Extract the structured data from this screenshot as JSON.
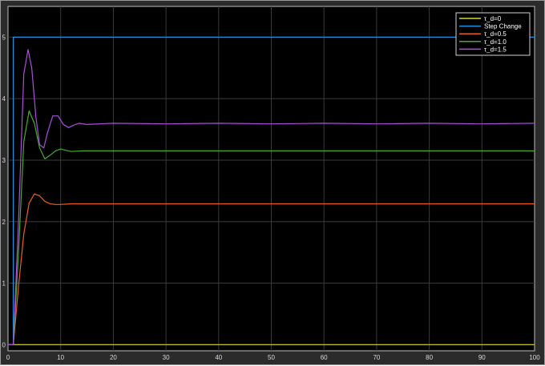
{
  "chart_data": {
    "type": "line",
    "title": "",
    "xlabel": "",
    "ylabel": "",
    "xlim": [
      0,
      100
    ],
    "ylim": [
      -0.1,
      5.5
    ],
    "grid": true,
    "legend_placement": "top-right",
    "x_ticks": [
      0,
      10,
      20,
      30,
      40,
      50,
      60,
      70,
      80,
      90,
      100
    ],
    "y_ticks": [
      0,
      1,
      2,
      3,
      4,
      5
    ],
    "background_color": "#000000",
    "grid_color": "#3a3a3a",
    "series": [
      {
        "name": "τ_d=0",
        "color": "#d6d62e",
        "points": [
          [
            0,
            0
          ],
          [
            100,
            0
          ]
        ]
      },
      {
        "name": "Step Change",
        "color": "#1f8fe0",
        "points": [
          [
            0,
            0
          ],
          [
            1,
            0
          ],
          [
            1,
            5
          ],
          [
            100,
            5
          ]
        ]
      },
      {
        "name": "τ_d=0.5",
        "color": "#e8601c",
        "points": [
          [
            0,
            0
          ],
          [
            1,
            0
          ],
          [
            2,
            0.95
          ],
          [
            3,
            1.8
          ],
          [
            4,
            2.3
          ],
          [
            5,
            2.45
          ],
          [
            6,
            2.42
          ],
          [
            7,
            2.33
          ],
          [
            8,
            2.29
          ],
          [
            9,
            2.28
          ],
          [
            10,
            2.28
          ],
          [
            12,
            2.29
          ],
          [
            20,
            2.29
          ],
          [
            40,
            2.29
          ],
          [
            60,
            2.29
          ],
          [
            80,
            2.29
          ],
          [
            100,
            2.29
          ]
        ]
      },
      {
        "name": "τ_d=1.0",
        "color": "#3fae2a",
        "points": [
          [
            0,
            0
          ],
          [
            1,
            0
          ],
          [
            2,
            1.5
          ],
          [
            3,
            3.3
          ],
          [
            4,
            3.8
          ],
          [
            5,
            3.6
          ],
          [
            6,
            3.2
          ],
          [
            7,
            3.02
          ],
          [
            8,
            3.08
          ],
          [
            9,
            3.15
          ],
          [
            10,
            3.18
          ],
          [
            11,
            3.16
          ],
          [
            12,
            3.14
          ],
          [
            14,
            3.15
          ],
          [
            20,
            3.15
          ],
          [
            40,
            3.15
          ],
          [
            60,
            3.15
          ],
          [
            80,
            3.15
          ],
          [
            100,
            3.15
          ]
        ]
      },
      {
        "name": "τ_d=1.5",
        "color": "#a84fd9",
        "points": [
          [
            0,
            0
          ],
          [
            1,
            0
          ],
          [
            2,
            2.0
          ],
          [
            3,
            4.4
          ],
          [
            3.8,
            4.8
          ],
          [
            4.5,
            4.5
          ],
          [
            5.3,
            3.7
          ],
          [
            6,
            3.25
          ],
          [
            6.8,
            3.2
          ],
          [
            7.5,
            3.45
          ],
          [
            8.5,
            3.72
          ],
          [
            9.5,
            3.72
          ],
          [
            10.5,
            3.58
          ],
          [
            11.5,
            3.53
          ],
          [
            12.5,
            3.57
          ],
          [
            13.5,
            3.6
          ],
          [
            15,
            3.58
          ],
          [
            20,
            3.6
          ],
          [
            30,
            3.59
          ],
          [
            40,
            3.6
          ],
          [
            50,
            3.59
          ],
          [
            60,
            3.6
          ],
          [
            70,
            3.59
          ],
          [
            80,
            3.6
          ],
          [
            90,
            3.59
          ],
          [
            100,
            3.6
          ]
        ]
      }
    ]
  }
}
